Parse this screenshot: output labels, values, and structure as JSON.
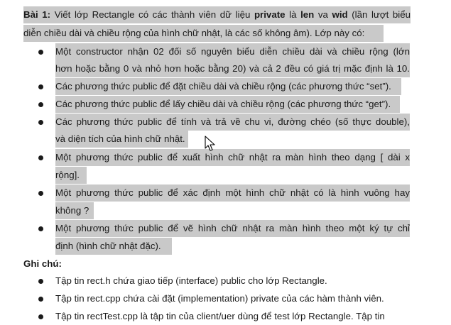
{
  "paragraph": {
    "title": "Bài 1:",
    "intro_segments": [
      "Viết lớp Rectangle có các thành viên dữ liệu ",
      "private",
      " là ",
      "len",
      " va ",
      "wid",
      " (lần lượt biểu"
    ],
    "intro_line2": "diễn chiều dài và chiều rộng của hình chữ nhật, là các số không âm). Lớp này có:"
  },
  "requirements": [
    {
      "lines": [
        "Một constructor nhận 02 đối số nguyên biểu diễn chiều dài và chiều rộng (lớn",
        "hơn hoặc bằng 0 và nhỏ hơn hoặc bằng 20) và cả 2 đều có giá trị mặc định là 10."
      ]
    },
    {
      "lines": [
        "Các phương thức public để đặt chiều dài và chiều rộng (các phương thức “set”)."
      ]
    },
    {
      "lines": [
        "Các phương thức public để lấy chiều dài và chiều rộng (các phương thức “get”)."
      ]
    },
    {
      "lines": [
        "Các phương thức public để tính và trả về chu vi, đường chéo (số thực double),",
        "và diện tích của hình chữ nhật."
      ]
    },
    {
      "lines": [
        "Một phương thức public để xuất hình chữ nhật ra màn hình theo dạng [ dài x",
        "rộng]."
      ]
    },
    {
      "lines": [
        "Một phương thức public để xác định một hình chữ nhật có là hình vuông hay",
        "không ?"
      ]
    },
    {
      "lines": [
        "Một phương thức public để vẽ hình chữ nhật ra màn hình theo một ký tự chỉ",
        "định (hình chữ nhật đặc)."
      ]
    }
  ],
  "notes": {
    "heading": "Ghi chú:",
    "items": [
      "Tập tin rect.h chứa giao tiếp (interface) public cho lớp Rectangle.",
      "Tập tin rect.cpp chứa cài đặt (implementation) private của các hàm thành viên.",
      "Tập tin rectTest.cpp là tập tin của client/uer dùng để test lớp Rectangle. Tập tin"
    ]
  },
  "colors": {
    "highlight": "#c9c9c9",
    "text": "#1a1a1a"
  },
  "icons": {
    "cursor": "mouse-pointer-icon"
  }
}
